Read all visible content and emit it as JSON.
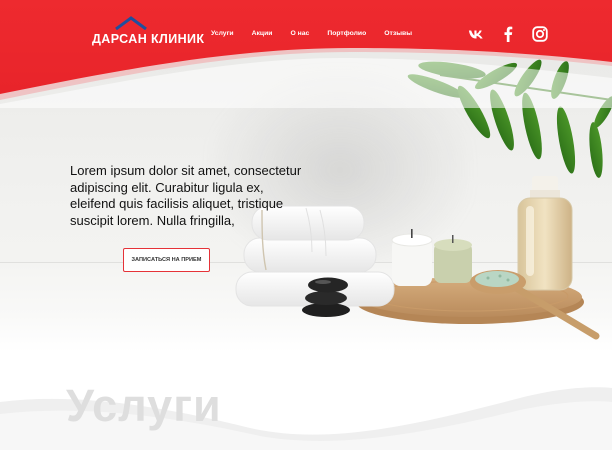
{
  "brand": {
    "name": "ДАРСАН КЛИНИК",
    "primary_color": "#ee2a2f",
    "accent_color": "#1f4f9e"
  },
  "nav": {
    "items": [
      "Услуги",
      "Акции",
      "О нас",
      "Портфолио",
      "Отзывы"
    ]
  },
  "socials": [
    {
      "name": "vk-icon"
    },
    {
      "name": "facebook-icon"
    },
    {
      "name": "instagram-icon"
    }
  ],
  "hero": {
    "text": "Lorem ipsum dolor sit amet, consectetur adipiscing elit. Curabitur ligula ex, eleifend quis facilisis aliquet, tristique suscipit lorem. Nulla fringilla,",
    "cta_label": "ЗАПИСАТЬСЯ НА ПРИЕМ"
  },
  "services": {
    "heading": "Услуги"
  }
}
